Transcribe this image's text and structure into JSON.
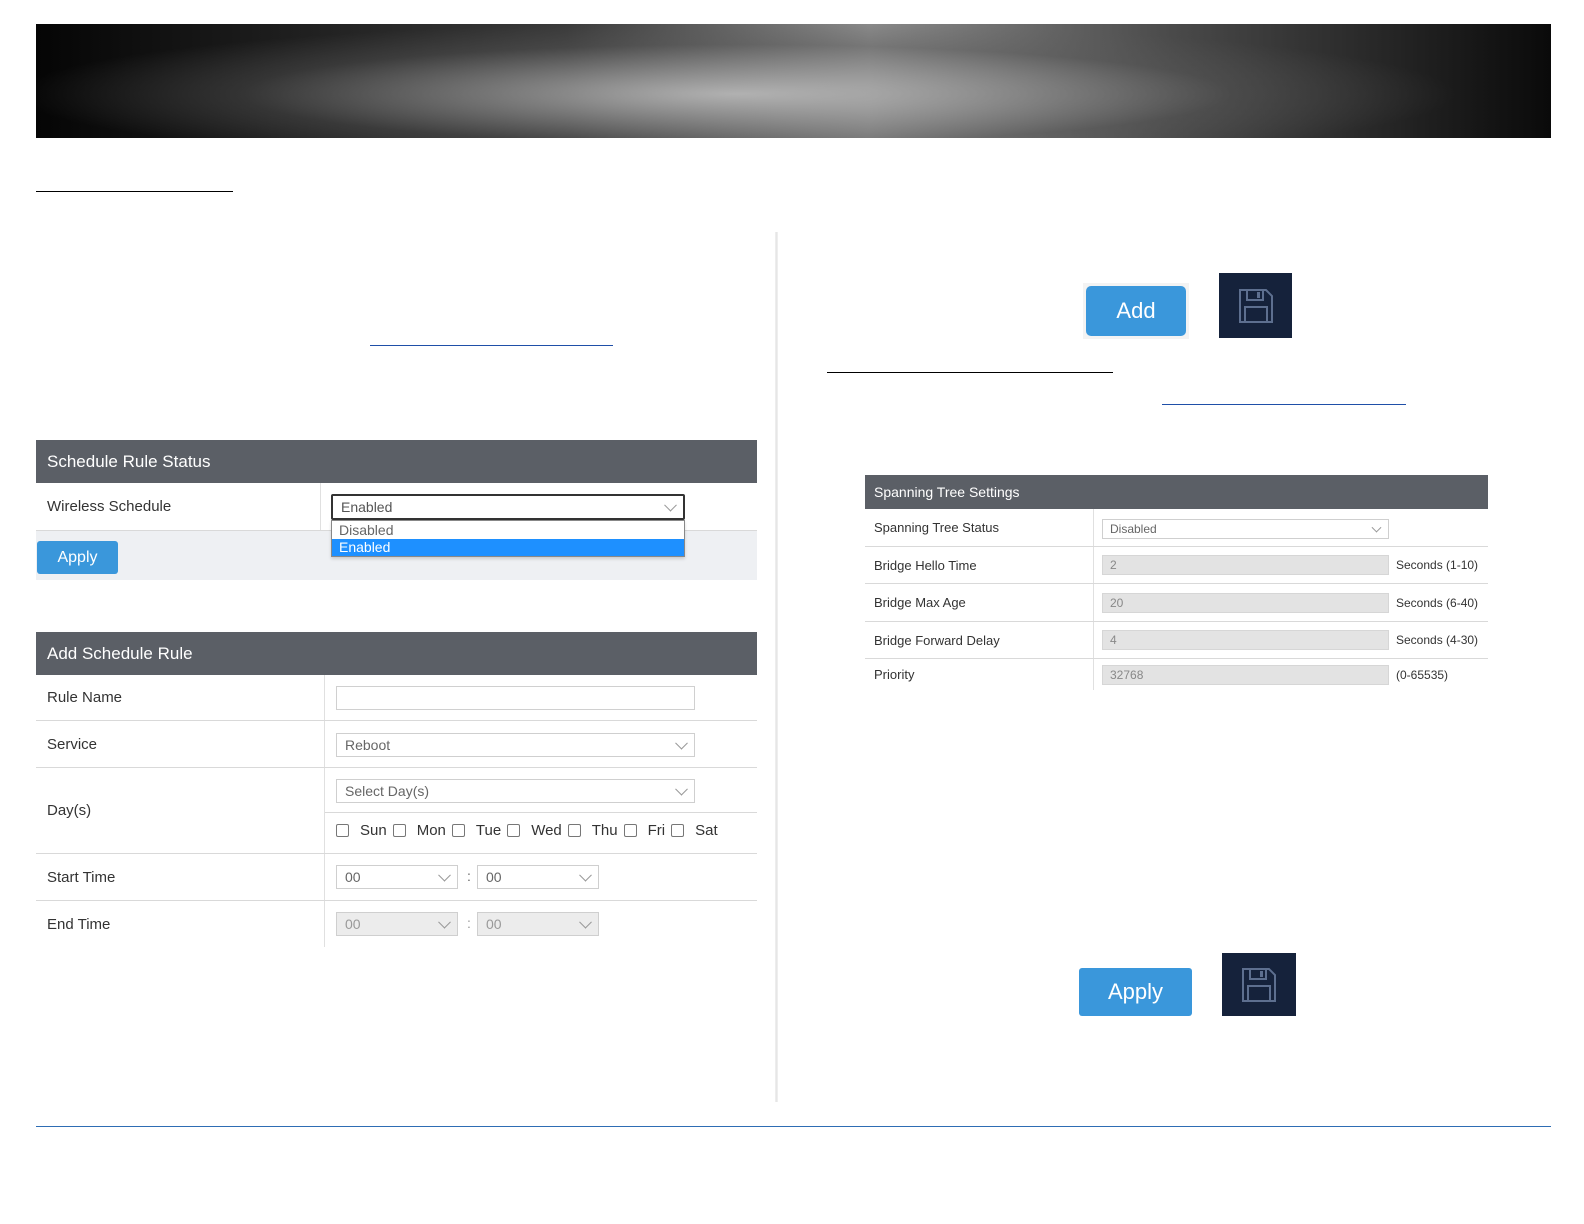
{
  "schedule_status": {
    "header": "Schedule Rule Status",
    "wireless_label": "Wireless Schedule",
    "selected": "Enabled",
    "options": [
      "Disabled",
      "Enabled"
    ],
    "apply_label": "Apply"
  },
  "add_rule": {
    "header": "Add Schedule Rule",
    "rule_name_label": "Rule Name",
    "rule_name_value": "",
    "service_label": "Service",
    "service_value": "Reboot",
    "days_label": "Day(s)",
    "days_select": "Select Day(s)",
    "days": [
      "Sun",
      "Mon",
      "Tue",
      "Wed",
      "Thu",
      "Fri",
      "Sat"
    ],
    "start_label": "Start Time",
    "start_hour": "00",
    "start_min": "00",
    "end_label": "End Time",
    "end_hour": "00",
    "end_min": "00",
    "time_sep": ":"
  },
  "buttons": {
    "add_label": "Add",
    "apply_label": "Apply"
  },
  "spanning_tree": {
    "header": "Spanning Tree Settings",
    "status_label": "Spanning Tree Status",
    "status_value": "Disabled",
    "hello_label": "Bridge Hello Time",
    "hello_value": "2",
    "hello_unit": "Seconds (1-10)",
    "maxage_label": "Bridge Max Age",
    "maxage_value": "20",
    "maxage_unit": "Seconds (6-40)",
    "fwd_label": "Bridge Forward Delay",
    "fwd_value": "4",
    "fwd_unit": "Seconds (4-30)",
    "priority_label": "Priority",
    "priority_value": "32768",
    "priority_unit": "(0-65535)"
  },
  "colors": {
    "accent": "#3a97db",
    "panel_header": "#5b5f66",
    "save_tile": "#15223b",
    "dropdown_highlight": "#1e90ff",
    "footer_line": "#2e6db4"
  }
}
